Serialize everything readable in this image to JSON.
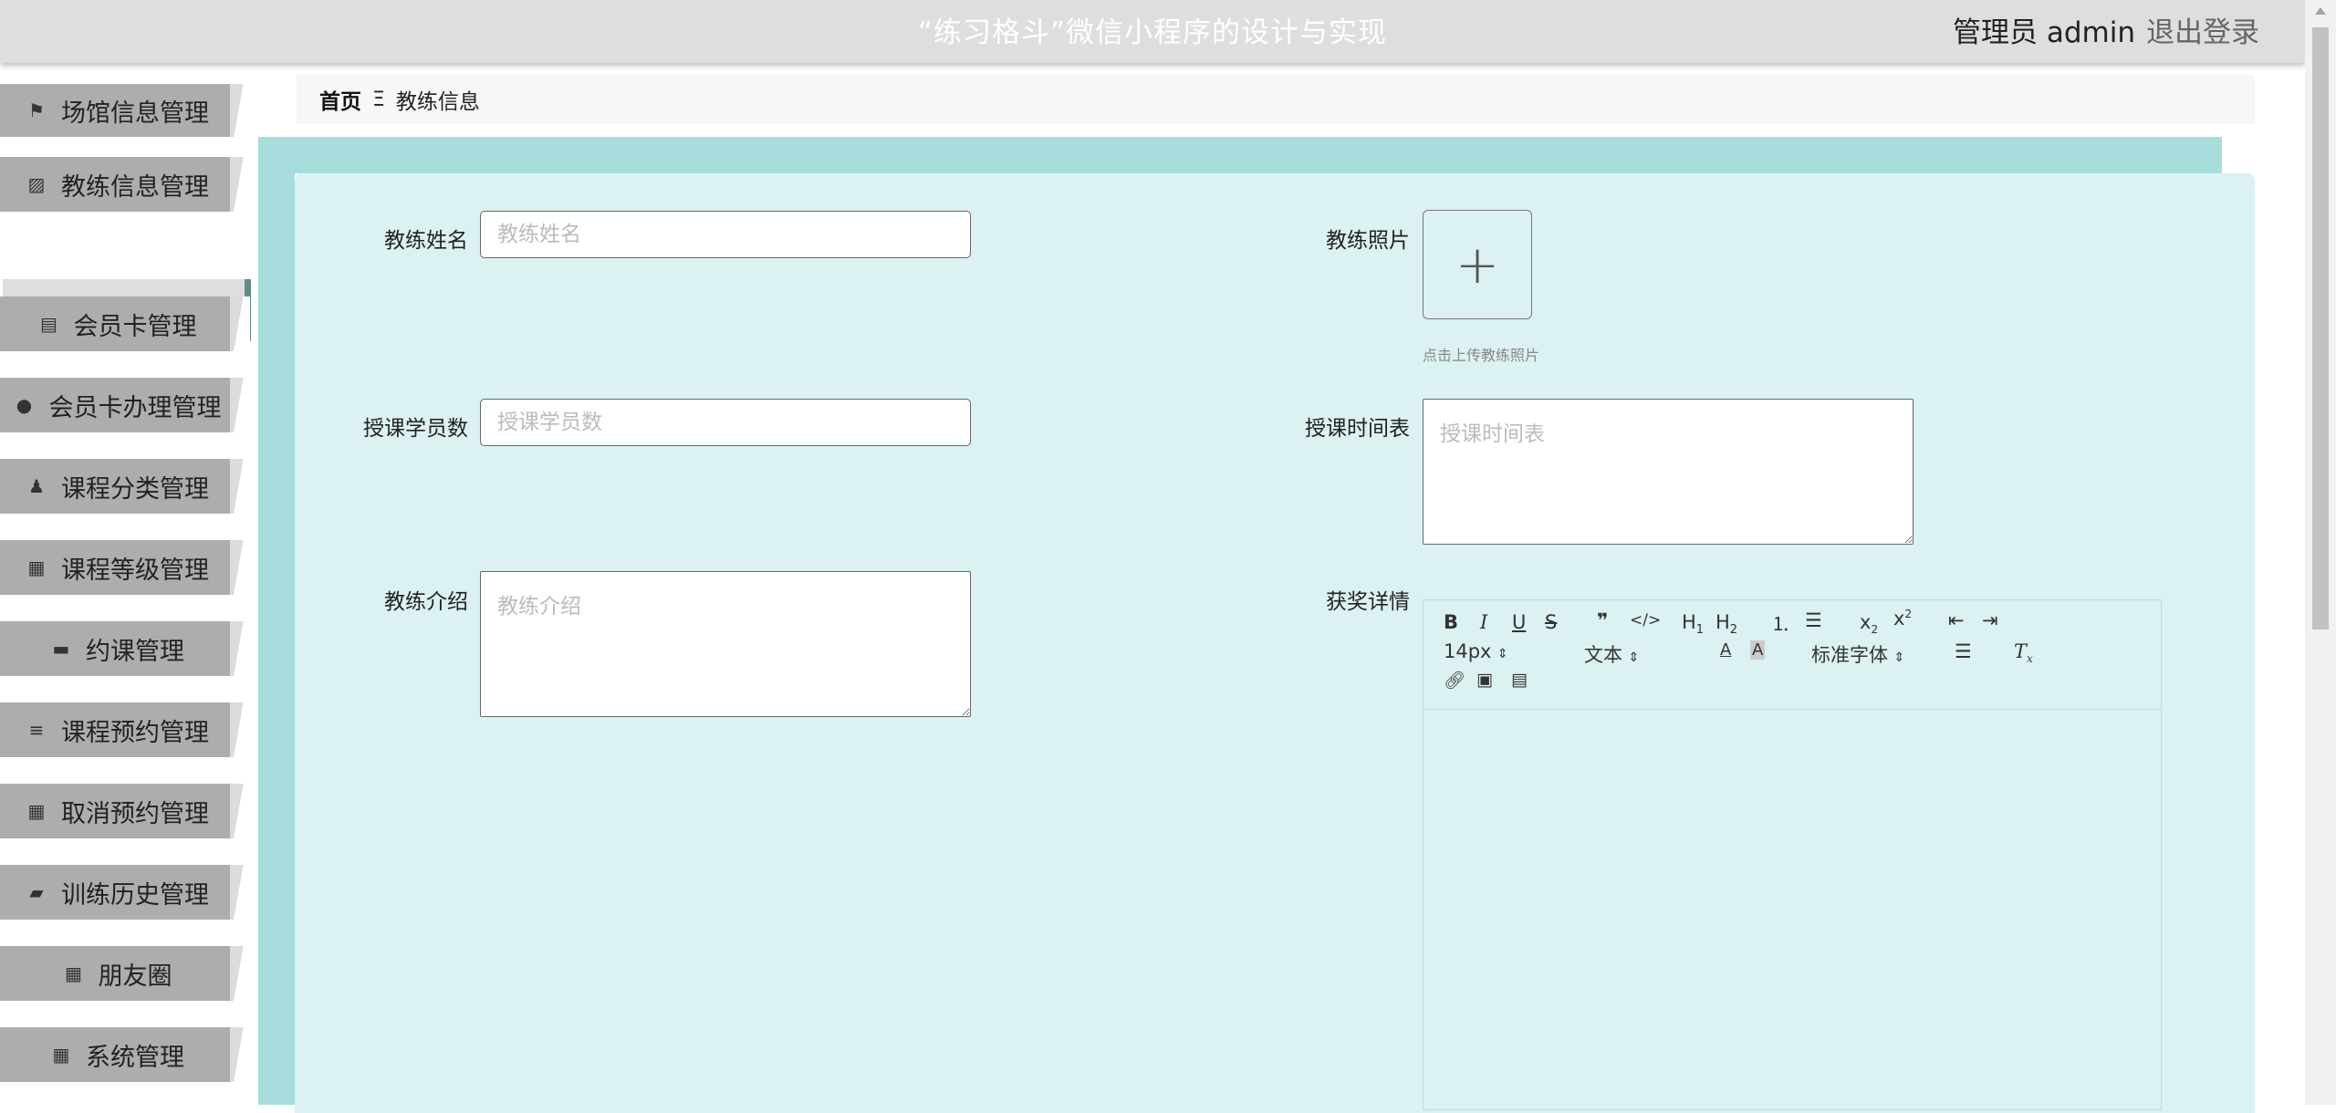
{
  "header": {
    "title": "“练习格斗”微信小程序的设计与实现",
    "user_label": "管理员 admin",
    "logout_label": "退出登录"
  },
  "sidebar": {
    "items": [
      {
        "label": "场馆信息管理",
        "icon": "flag-icon",
        "glyph": "⚑"
      },
      {
        "label": "教练信息管理",
        "icon": "chart-icon",
        "glyph": "▨"
      },
      {
        "label": "会员卡管理",
        "icon": "clipboard-icon",
        "glyph": "▤"
      },
      {
        "label": "会员卡办理管理",
        "icon": "bulb-icon",
        "glyph": "●"
      },
      {
        "label": "课程分类管理",
        "icon": "user-icon",
        "glyph": "♟"
      },
      {
        "label": "课程等级管理",
        "icon": "grid-icon",
        "glyph": "▦"
      },
      {
        "label": "约课管理",
        "icon": "briefcase-icon",
        "glyph": "▬"
      },
      {
        "label": "课程预约管理",
        "icon": "list-icon",
        "glyph": "≡"
      },
      {
        "label": "取消预约管理",
        "icon": "grid-icon",
        "glyph": "▦"
      },
      {
        "label": "训练历史管理",
        "icon": "wallet-icon",
        "glyph": "▰"
      },
      {
        "label": "朋友圈",
        "icon": "grid-icon",
        "glyph": "▦"
      },
      {
        "label": "系统管理",
        "icon": "grid-icon",
        "glyph": "▦"
      }
    ],
    "active_sub": "教练信息"
  },
  "breadcrumb": {
    "home": "首页",
    "separator": "Ξ",
    "current": "教练信息"
  },
  "form": {
    "name_label": "教练姓名",
    "name_placeholder": "教练姓名",
    "photo_label": "教练照片",
    "upload_hint": "点击上传教练照片",
    "students_label": "授课学员数",
    "students_placeholder": "授课学员数",
    "schedule_label": "授课时间表",
    "schedule_placeholder": "授课时间表",
    "intro_label": "教练介绍",
    "intro_placeholder": "教练介绍",
    "awards_label": "获奖详情"
  },
  "editor": {
    "font_size": "14px",
    "paragraph": "文本",
    "font_family": "标准字体"
  }
}
